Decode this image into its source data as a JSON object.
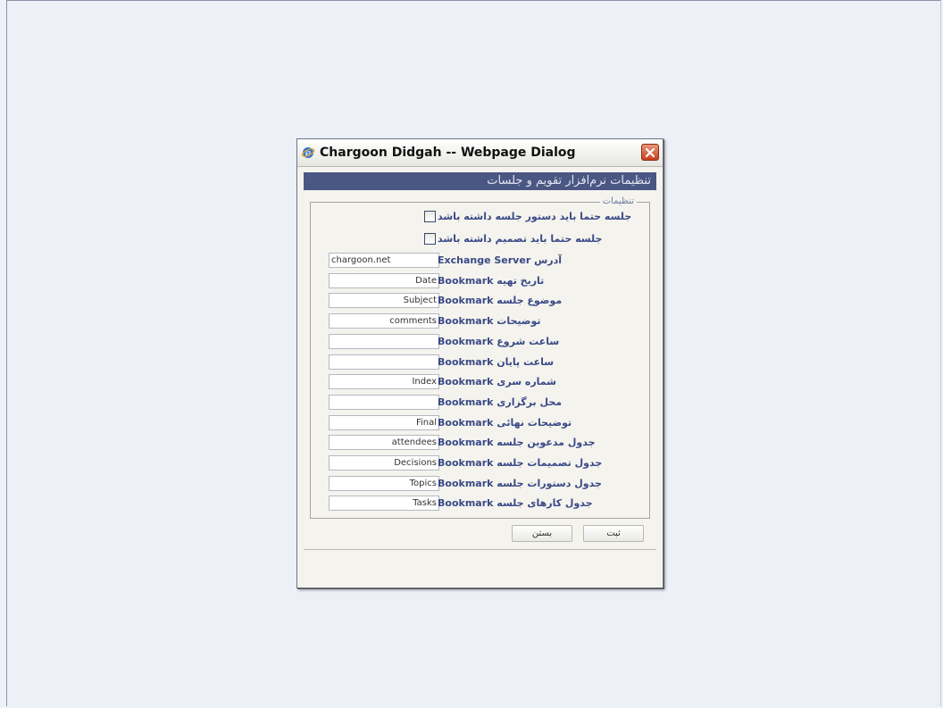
{
  "dialog": {
    "title": "Chargoon Didgah -- Webpage Dialog",
    "header": "تنظیمات نرم‌افزار تقویم و جلسات",
    "legend": "تنظیمات"
  },
  "checkboxes": [
    {
      "label": "جلسه حتما باید دستور جلسه داشته باشد",
      "checked": false
    },
    {
      "label": "جلسه حتما باید تصمیم داشته باشد",
      "checked": false
    }
  ],
  "fields": [
    {
      "label": "آدرس Exchange Server",
      "value": "chargoon.net"
    },
    {
      "label": "Bookmark تاریخ تهیه",
      "value": "Date"
    },
    {
      "label": "Bookmark موضوع جلسه",
      "value": "Subject"
    },
    {
      "label": "Bookmark توضیحات",
      "value": "comments"
    },
    {
      "label": "Bookmark ساعت شروع",
      "value": ""
    },
    {
      "label": "Bookmark ساعت پایان",
      "value": ""
    },
    {
      "label": "Bookmark شماره سری",
      "value": "Index"
    },
    {
      "label": "Bookmark محل برگزاری",
      "value": ""
    },
    {
      "label": "Bookmark توضیحات نهائی",
      "value": "Final"
    },
    {
      "label": "Bookmark جدول مدعوین جلسه",
      "value": "attendees"
    },
    {
      "label": "Bookmark جدول تصمیمات جلسه",
      "value": "Decisions"
    },
    {
      "label": "Bookmark جدول دستورات جلسه",
      "value": "Topics"
    },
    {
      "label": "Bookmark جدول کارهای جلسه",
      "value": "Tasks"
    }
  ],
  "buttons": {
    "submit": "ثبت",
    "close": "بستن"
  },
  "icons": {
    "app": "ie-icon",
    "close": "close-icon"
  }
}
